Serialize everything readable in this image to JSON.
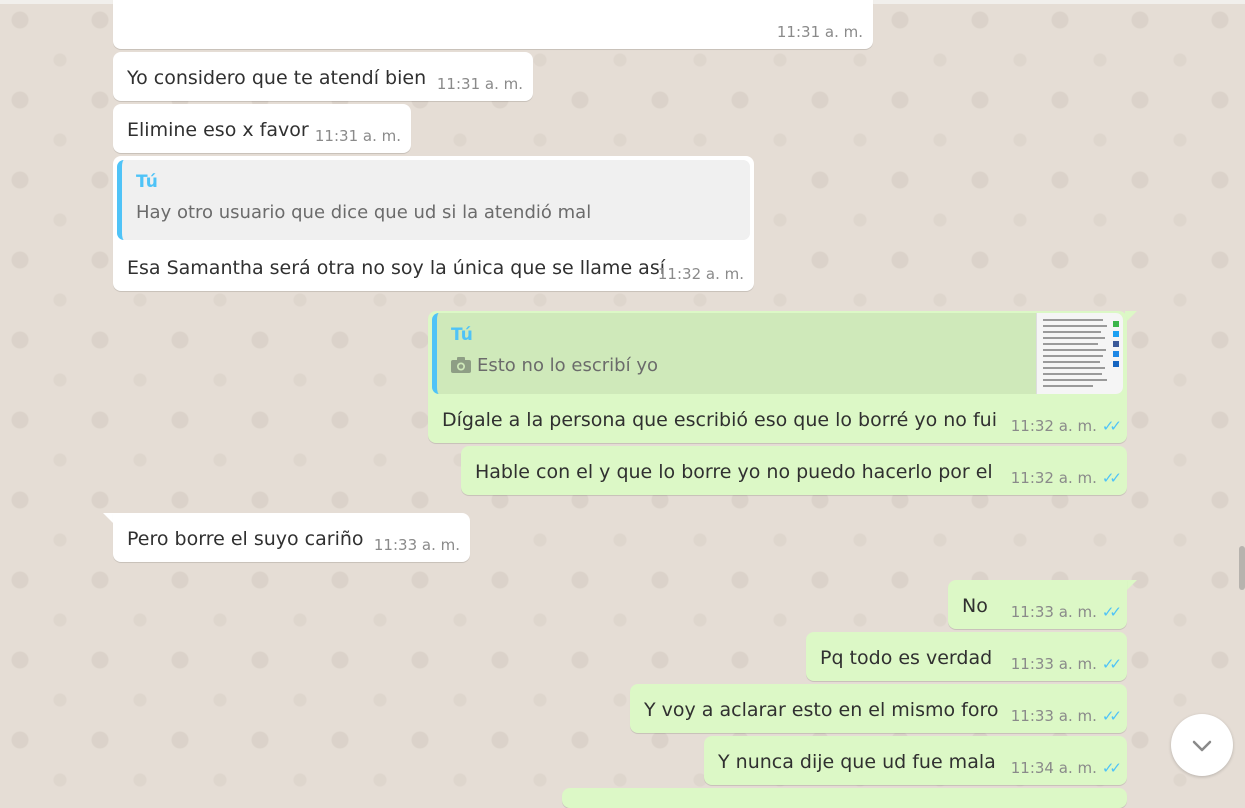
{
  "messages": [
    {
      "text": "",
      "time": "11:31 a. m."
    },
    {
      "text": "Yo considero que te atendí bien",
      "time": "11:31 a. m."
    },
    {
      "text": "Elimine eso x favor",
      "time": "11:31 a. m."
    },
    {
      "quote_author": "Tú",
      "quote_text": "Hay otro usuario que dice que ud si la atendió mal",
      "text": "Esa Samantha será otra no soy la única que se llame así",
      "time": "11:32 a. m."
    },
    {
      "quote_author": "Tú",
      "quote_text": "Esto no lo escribí yo",
      "text": "Dígale a la persona que escribió eso que lo borré yo no fui",
      "time": "11:32 a. m."
    },
    {
      "text": "Hable con el y que lo borre yo no puedo hacerlo por el",
      "time": "11:32 a. m."
    },
    {
      "text": "Pero borre el suyo cariño",
      "time": "11:33 a. m."
    },
    {
      "text": "No",
      "time": "11:33 a. m."
    },
    {
      "text": "Pq todo es verdad",
      "time": "11:33 a. m."
    },
    {
      "text": "Y voy a aclarar esto en el mismo foro",
      "time": "11:33 a. m."
    },
    {
      "text": "Y nunca dije que ud fue mala",
      "time": "11:34 a. m."
    }
  ],
  "icons": {
    "read_receipt": "double-check-icon",
    "photo": "camera-icon",
    "scroll_down": "chevron-down-icon"
  },
  "colors": {
    "incoming_bubble": "#ffffff",
    "outgoing_bubble": "#dcf8c6",
    "quote_accent": "#4fc3f7",
    "read_tick": "#4fc3f7",
    "wallpaper": "#e5ddd5"
  }
}
